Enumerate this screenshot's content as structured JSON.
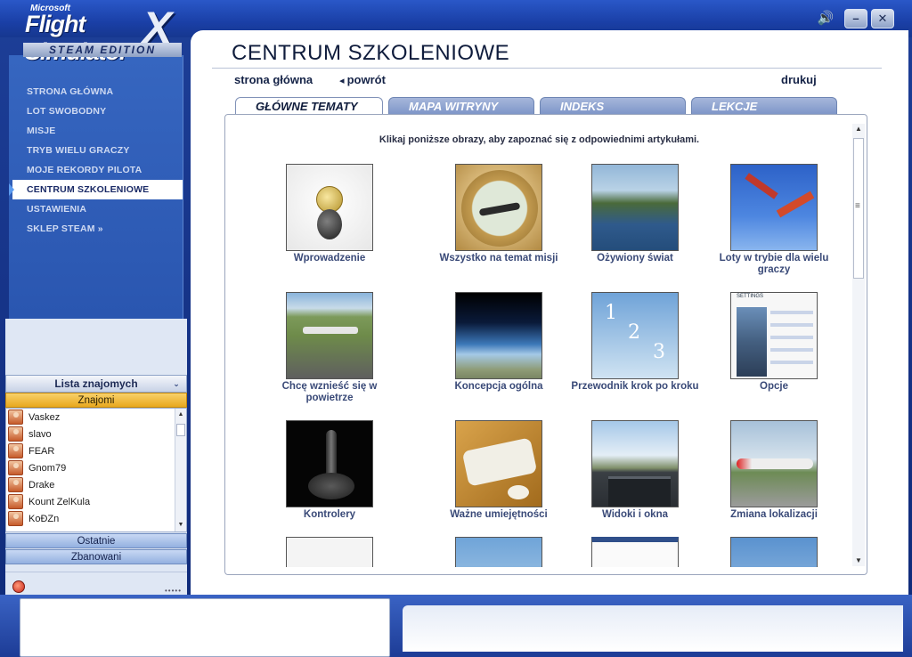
{
  "app": {
    "brand_small": "Microsoft",
    "brand_name": "Flight Simulator",
    "brand_x": "X",
    "brand_edition": "STEAM EDITION"
  },
  "window_controls": {
    "speaker_icon": "speaker-icon",
    "minimize_label": "–",
    "close_label": "✕"
  },
  "nav": {
    "items": [
      {
        "label": "STRONA GŁÓWNA"
      },
      {
        "label": "LOT SWOBODNY"
      },
      {
        "label": "MISJE"
      },
      {
        "label": "TRYB WIELU GRACZY"
      },
      {
        "label": "MOJE REKORDY PILOTA"
      },
      {
        "label": "CENTRUM SZKOLENIOWE",
        "active": true
      },
      {
        "label": "USTAWIENIA"
      },
      {
        "label": "SKLEP STEAM »"
      }
    ]
  },
  "friends": {
    "header": "Lista znajomych",
    "tab_friends": "Znajomi",
    "list": [
      "Vaskez",
      "slavo",
      "FEAR",
      "Gnom79",
      "Drake",
      "Kount ZelKula",
      "KoĐZn"
    ],
    "tab_recent": "Ostatnie",
    "tab_banned": "Zbanowani"
  },
  "page": {
    "title": "CENTRUM SZKOLENIOWE",
    "link_home": "strona główna",
    "link_back": "powrót",
    "link_print": "drukuj",
    "tabs": [
      {
        "label": "GŁÓWNE TEMATY",
        "active": true
      },
      {
        "label": "MAPA WITRYNY",
        "active": false
      },
      {
        "label": "INDEKS",
        "active": false
      },
      {
        "label": "LEKCJE",
        "active": false
      }
    ],
    "intro": "Klikaj poniższe obrazy, aby zapoznać się z odpowiednimi artykułami."
  },
  "topics": [
    {
      "caption": "Wprowadzenie",
      "icon": "key-icon"
    },
    {
      "caption": "Wszystko na temat misji",
      "icon": "mission-badge-icon"
    },
    {
      "caption": "Ożywiony świat",
      "icon": "harbor-image"
    },
    {
      "caption": "Loty w trybie dla wielu graczy",
      "icon": "airshow-image"
    },
    {
      "caption": "Chcę wznieść się w powietrze",
      "icon": "takeoff-image"
    },
    {
      "caption": "Koncepcja ogólna",
      "icon": "earth-horizon-image"
    },
    {
      "caption": "Przewodnik krok po kroku",
      "icon": "steps-image",
      "steps": [
        "1",
        "2",
        "3"
      ]
    },
    {
      "caption": "Opcje",
      "icon": "settings-screen-image",
      "screen_label": "SETTINGS"
    },
    {
      "caption": "Kontrolery",
      "icon": "joystick-image"
    },
    {
      "caption": "Ważne umiejętności",
      "icon": "keyboard-mouse-image"
    },
    {
      "caption": "Widoki i okna",
      "icon": "cockpit-image"
    },
    {
      "caption": "Zmiana lokalizacji",
      "icon": "airport-jet-image"
    }
  ],
  "colors": {
    "accent_blue": "#1d3f98",
    "caption_color": "#3a4a78",
    "friends_tab_yellow": "#e8a81e"
  }
}
